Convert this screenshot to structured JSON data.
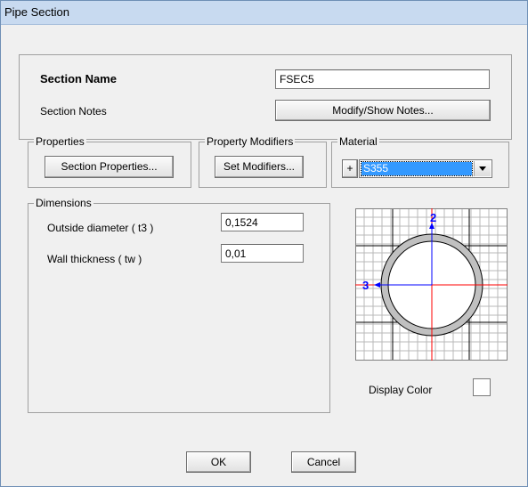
{
  "window": {
    "title": "Pipe Section"
  },
  "section": {
    "name_label": "Section Name",
    "name_value": "FSEC5",
    "notes_label": "Section Notes",
    "notes_button": "Modify/Show Notes..."
  },
  "properties": {
    "group_title": "Properties",
    "button": "Section Properties..."
  },
  "modifiers": {
    "group_title": "Property Modifiers",
    "button": "Set Modifiers..."
  },
  "material": {
    "group_title": "Material",
    "plus": "+",
    "selected": "S355"
  },
  "dimensions": {
    "group_title": "Dimensions",
    "outside_diameter_label": "Outside diameter  ( t3 )",
    "outside_diameter_value": "0,1524",
    "wall_thickness_label": "Wall thickness  ( tw )",
    "wall_thickness_value": "0,01"
  },
  "preview": {
    "axis_2_label": "2",
    "axis_3_label": "3"
  },
  "display_color": {
    "label": "Display Color"
  },
  "footer": {
    "ok": "OK",
    "cancel": "Cancel"
  },
  "icons": {
    "dropdown": "chevron-down-icon"
  },
  "colors": {
    "titlebar": "#c8daf0",
    "selection": "#3399ff",
    "axis_blue": "#0000ff",
    "axis_red": "#ff0000",
    "pipe_fill": "#c0c0c0"
  }
}
